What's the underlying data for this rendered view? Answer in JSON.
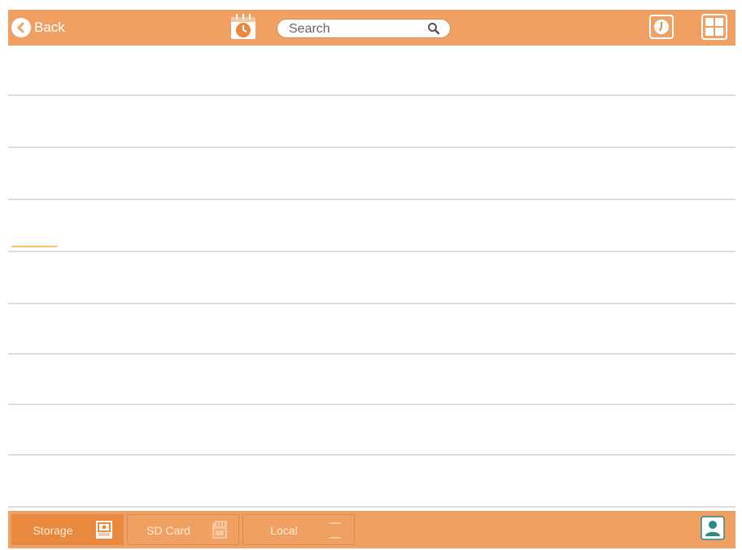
{
  "header": {
    "back_label": "Back",
    "search": {
      "placeholder": "Search",
      "value": ""
    }
  },
  "list": {
    "row_count": 9
  },
  "footer": {
    "tabs": [
      {
        "label": "Storage",
        "icon": "storage-icon",
        "active": true
      },
      {
        "label": "SD Card",
        "icon": "sdcard-icon",
        "active": false
      },
      {
        "label": "Local",
        "icon": "local-icon",
        "active": false
      }
    ]
  },
  "colors": {
    "bar": "#f0a062",
    "active_tab": "#e8893f",
    "divider": "#dcdcdc",
    "accent": "#f5c56a",
    "avatar": "#2a8a88"
  }
}
